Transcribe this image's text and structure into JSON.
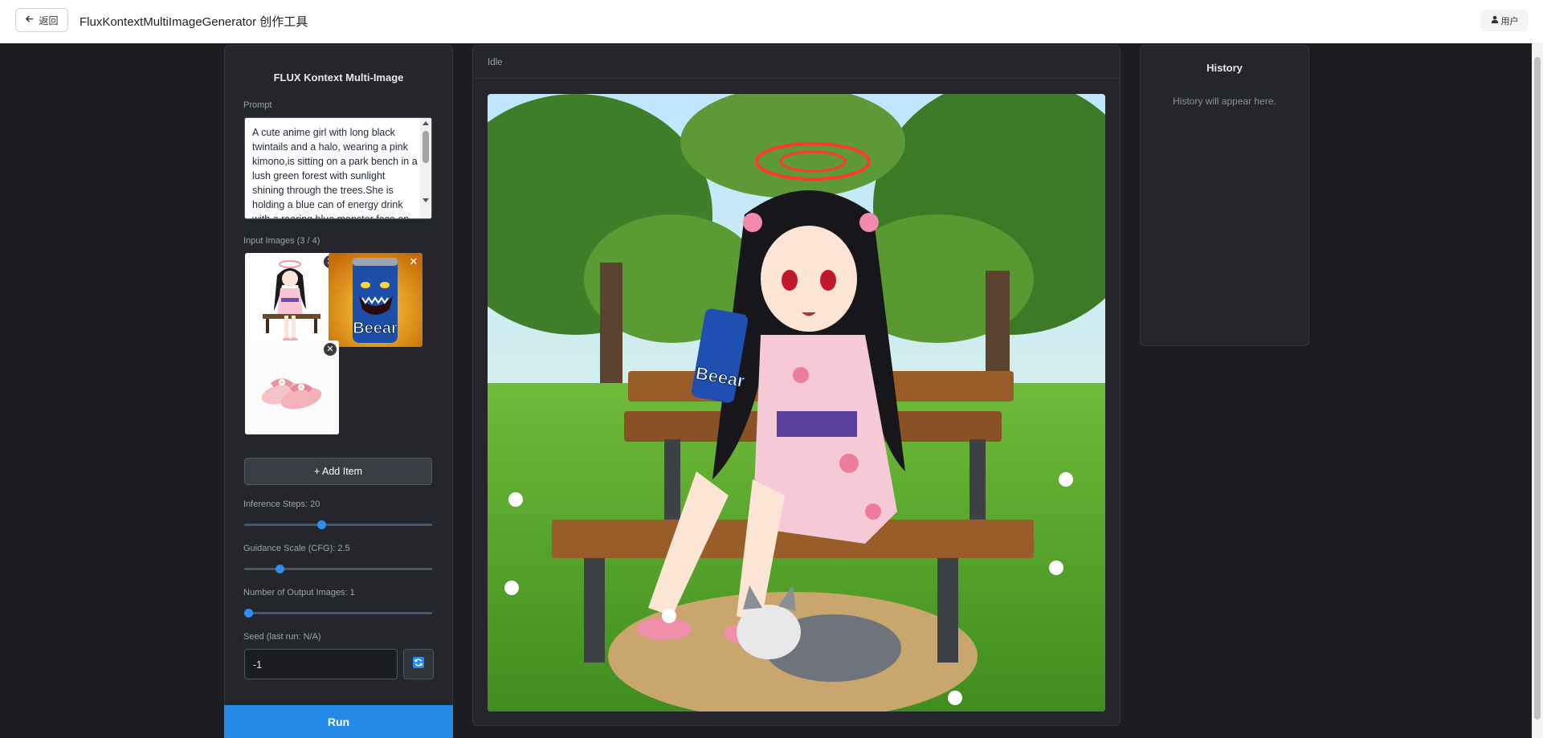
{
  "header": {
    "back_label": "返回",
    "title": "FluxKontextMultiImageGenerator 创作工具",
    "user_label": "用户"
  },
  "left_panel": {
    "title": "FLUX Kontext Multi-Image",
    "prompt_label": "Prompt",
    "prompt_value": "A cute anime girl with long black twintails and a halo, wearing a pink kimono,is sitting on a park bench in a lush green forest with sunlight shining through the trees.She is holding a blue can of energy drink with a roaring blue monster face on",
    "input_images_label": "Input Images (3 / 4)",
    "input_images": [
      {
        "name": "anime-girl-on-bench-thumbnail",
        "caption": ""
      },
      {
        "name": "energy-drink-can-thumbnail",
        "caption": "Beear"
      },
      {
        "name": "pink-slippers-thumbnail",
        "caption": ""
      }
    ],
    "add_item_label": "+ Add Item",
    "steps": {
      "label": "Inference Steps: 20",
      "value": 20,
      "min": 1,
      "max": 50
    },
    "cfg": {
      "label": "Guidance Scale (CFG): 2.5",
      "value": 2.5,
      "min": 1,
      "max": 10
    },
    "num_images": {
      "label": "Number of Output Images: 1",
      "value": 1,
      "min": 1,
      "max": 4
    },
    "seed_label": "Seed (last run: N/A)",
    "seed_value": "-1",
    "run_label": "Run"
  },
  "center_panel": {
    "status": "Idle",
    "output_can_text": "Beear"
  },
  "history": {
    "title": "History",
    "empty_text": "History will appear here."
  },
  "colors": {
    "accent": "#2589e8",
    "panel_bg": "#24262b",
    "page_bg": "#1b1d21"
  }
}
